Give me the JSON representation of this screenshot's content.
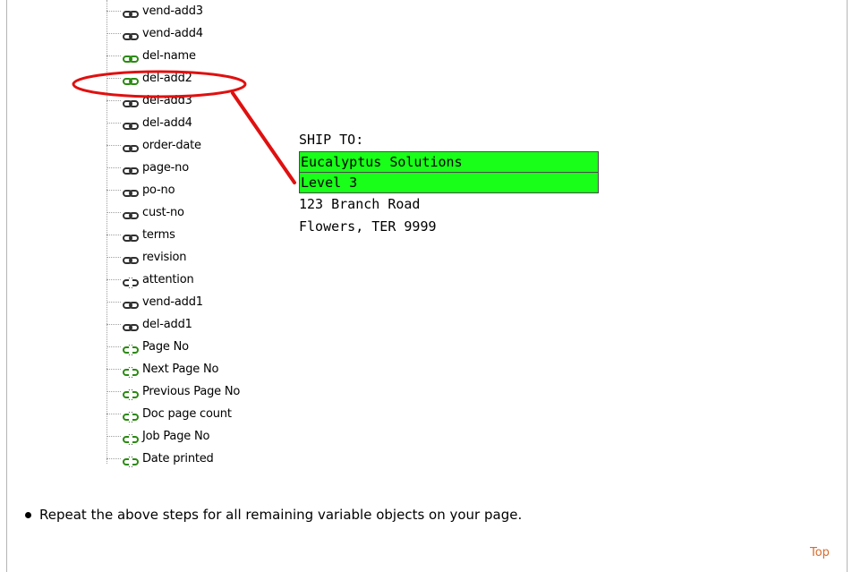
{
  "tree": {
    "items": [
      {
        "label": "vend-add3",
        "kind": "normal"
      },
      {
        "label": "vend-add4",
        "kind": "normal"
      },
      {
        "label": "del-name",
        "kind": "green"
      },
      {
        "label": "del-add2",
        "kind": "green"
      },
      {
        "label": "del-add3",
        "kind": "normal"
      },
      {
        "label": "del-add4",
        "kind": "normal"
      },
      {
        "label": "order-date",
        "kind": "normal"
      },
      {
        "label": "page-no",
        "kind": "normal"
      },
      {
        "label": "po-no",
        "kind": "normal"
      },
      {
        "label": "cust-no",
        "kind": "normal"
      },
      {
        "label": "terms",
        "kind": "normal"
      },
      {
        "label": "revision",
        "kind": "normal"
      },
      {
        "label": "attention",
        "kind": "broken"
      },
      {
        "label": "vend-add1",
        "kind": "normal"
      },
      {
        "label": "del-add1",
        "kind": "normal"
      },
      {
        "label": "Page No",
        "kind": "broken-green"
      },
      {
        "label": "Next Page No",
        "kind": "broken-green"
      },
      {
        "label": "Previous Page No",
        "kind": "broken-green"
      },
      {
        "label": "Doc page count",
        "kind": "broken-green"
      },
      {
        "label": "Job Page No",
        "kind": "broken-green"
      },
      {
        "label": "Date printed",
        "kind": "broken-green"
      }
    ]
  },
  "ship_to": {
    "heading": "SHIP TO:",
    "line1": "Eucalyptus Solutions",
    "line2": "Level 3",
    "line3": "123 Branch Road",
    "line4": "Flowers, TER 9999"
  },
  "instruction": {
    "text": "Repeat the above steps for all remaining variable objects on your page."
  },
  "footer": {
    "top_link": "Top"
  },
  "colors": {
    "highlight": "#19ff19",
    "annotation": "#e01010",
    "link": "#d96a2a"
  }
}
